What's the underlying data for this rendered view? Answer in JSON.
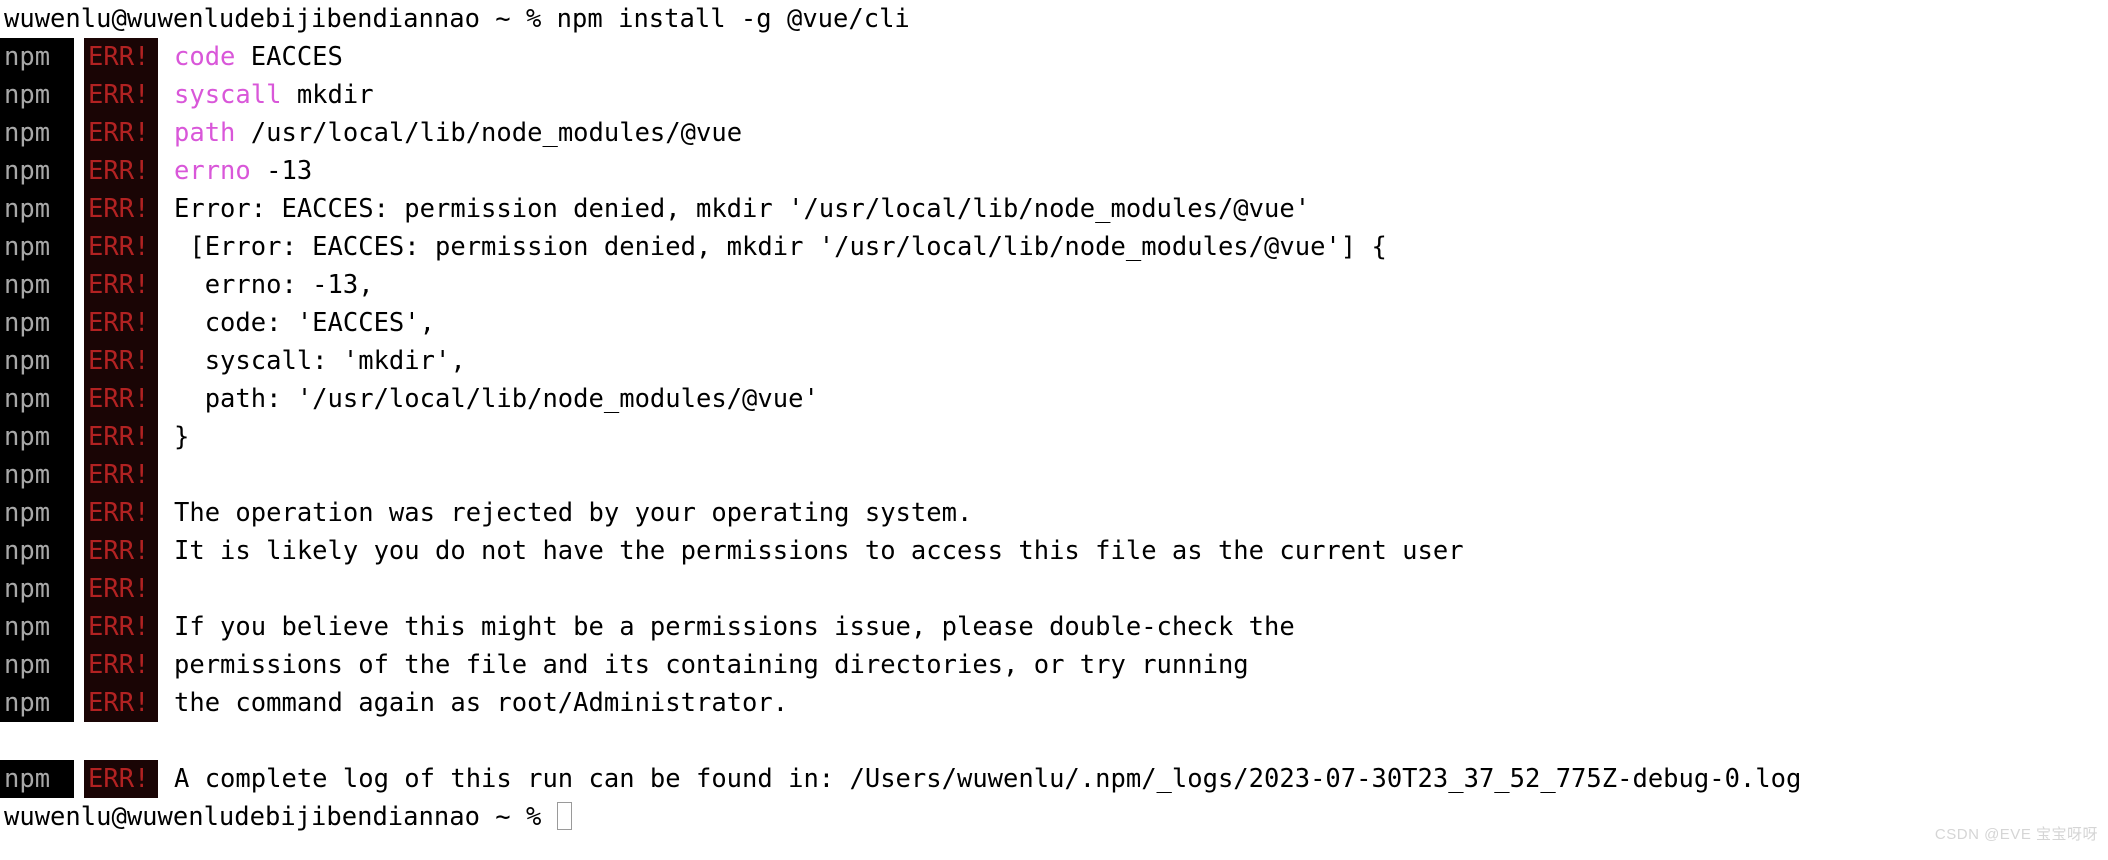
{
  "terminal": {
    "prompt_line": "wuwenlu@wuwenludebijibendiannao ~ % npm install -g @vue/cli",
    "final_prompt": "wuwenlu@wuwenludebijibendiannao ~ % ",
    "badge_npm": "npm",
    "badge_err": "ERR!",
    "colors": {
      "background": "#ffffff",
      "foreground": "#000000",
      "npm_badge_bg": "#000000",
      "npm_badge_fg": "#a8a8a8",
      "err_badge_bg": "#1a0505",
      "err_badge_fg": "#b22222",
      "keyword": "#d957d9",
      "cursor_border": "#9a9a9a"
    },
    "lines": [
      {
        "kind": "err",
        "keyword": "code",
        "text": " EACCES"
      },
      {
        "kind": "err",
        "keyword": "syscall",
        "text": " mkdir"
      },
      {
        "kind": "err",
        "keyword": "path",
        "text": " /usr/local/lib/node_modules/@vue"
      },
      {
        "kind": "err",
        "keyword": "errno",
        "text": " -13"
      },
      {
        "kind": "err",
        "keyword": "",
        "text": "Error: EACCES: permission denied, mkdir '/usr/local/lib/node_modules/@vue'"
      },
      {
        "kind": "err",
        "keyword": "",
        "text": " [Error: EACCES: permission denied, mkdir '/usr/local/lib/node_modules/@vue'] {"
      },
      {
        "kind": "err",
        "keyword": "",
        "text": "  errno: -13,"
      },
      {
        "kind": "err",
        "keyword": "",
        "text": "  code: 'EACCES',"
      },
      {
        "kind": "err",
        "keyword": "",
        "text": "  syscall: 'mkdir',"
      },
      {
        "kind": "err",
        "keyword": "",
        "text": "  path: '/usr/local/lib/node_modules/@vue'"
      },
      {
        "kind": "err",
        "keyword": "",
        "text": "}"
      },
      {
        "kind": "err",
        "keyword": "",
        "text": ""
      },
      {
        "kind": "err",
        "keyword": "",
        "text": "The operation was rejected by your operating system."
      },
      {
        "kind": "err",
        "keyword": "",
        "text": "It is likely you do not have the permissions to access this file as the current user"
      },
      {
        "kind": "err",
        "keyword": "",
        "text": ""
      },
      {
        "kind": "err",
        "keyword": "",
        "text": "If you believe this might be a permissions issue, please double-check the"
      },
      {
        "kind": "err",
        "keyword": "",
        "text": "permissions of the file and its containing directories, or try running"
      },
      {
        "kind": "err",
        "keyword": "",
        "text": "the command again as root/Administrator."
      },
      {
        "kind": "gap",
        "keyword": "",
        "text": ""
      },
      {
        "kind": "err",
        "keyword": "",
        "text": "A complete log of this run can be found in: /Users/wuwenlu/.npm/_logs/2023-07-30T23_37_52_775Z-debug-0.log"
      }
    ]
  },
  "watermark": {
    "text": "CSDN @EVE 宝宝呀呀"
  }
}
